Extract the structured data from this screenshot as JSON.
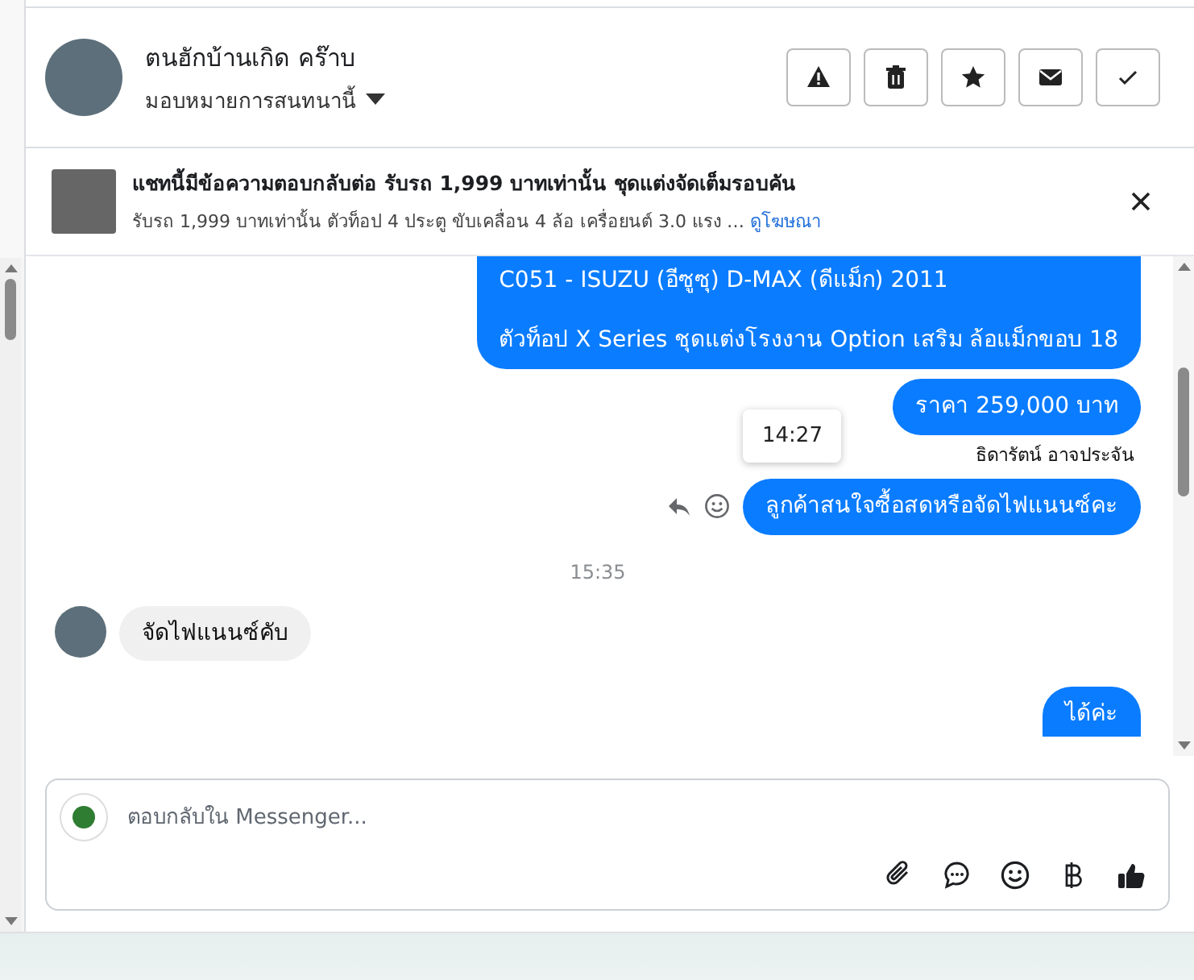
{
  "header": {
    "name": "ตนฮักบ้านเกิด คร๊าบ",
    "subtitle": "มอบหมายการสนทนานี้",
    "actions": [
      {
        "kind": "report"
      },
      {
        "kind": "delete"
      },
      {
        "kind": "star"
      },
      {
        "kind": "mail"
      },
      {
        "kind": "done"
      }
    ]
  },
  "ad_banner": {
    "title": "แชทนี้มีข้อความตอบกลับต่อ รับรถ 1,999 บาทเท่านั้น ชุดแต่งจัดเต็มรอบคัน",
    "description": "รับรถ 1,999 บาทเท่านั้น ตัวท็อป 4 ประตู ขับเคลื่อน 4 ล้อ เครื่อยนต์ 3.0 แรง …",
    "link": "ดูโฆษณา"
  },
  "messages": [
    {
      "kind": "outgoing",
      "paragraphs": [
        "C051 - ISUZU (อีซูซุ) D-MAX (ดีแม็ก) 2011",
        "ตัวท็อป X Series ชุดแต่งโรงงาน Option เสริม ล้อแม็กขอบ 18"
      ]
    },
    {
      "kind": "outgoing",
      "paragraphs": [
        "ราคา 259,000 บาท"
      ],
      "sender": "ธิดารัตน์ อาจประจัน"
    },
    {
      "kind": "outgoing",
      "paragraphs": [
        "ลูกค้าสนใจซื้อสดหรือจัดไฟแนนซ์คะ"
      ],
      "tooltip": "14:27",
      "hover_actions": true
    },
    {
      "kind": "timestamp",
      "text": "15:35"
    },
    {
      "kind": "incoming",
      "paragraphs": [
        "จัดไฟแนนซ์คับ"
      ]
    },
    {
      "kind": "outgoing",
      "paragraphs": [
        "ได้ค่ะ"
      ]
    }
  ],
  "composer": {
    "placeholder": "ตอบกลับใน Messenger...",
    "tools": [
      {
        "kind": "attach"
      },
      {
        "kind": "chat"
      },
      {
        "kind": "emoji"
      },
      {
        "kind": "baht"
      },
      {
        "kind": "like"
      }
    ]
  }
}
